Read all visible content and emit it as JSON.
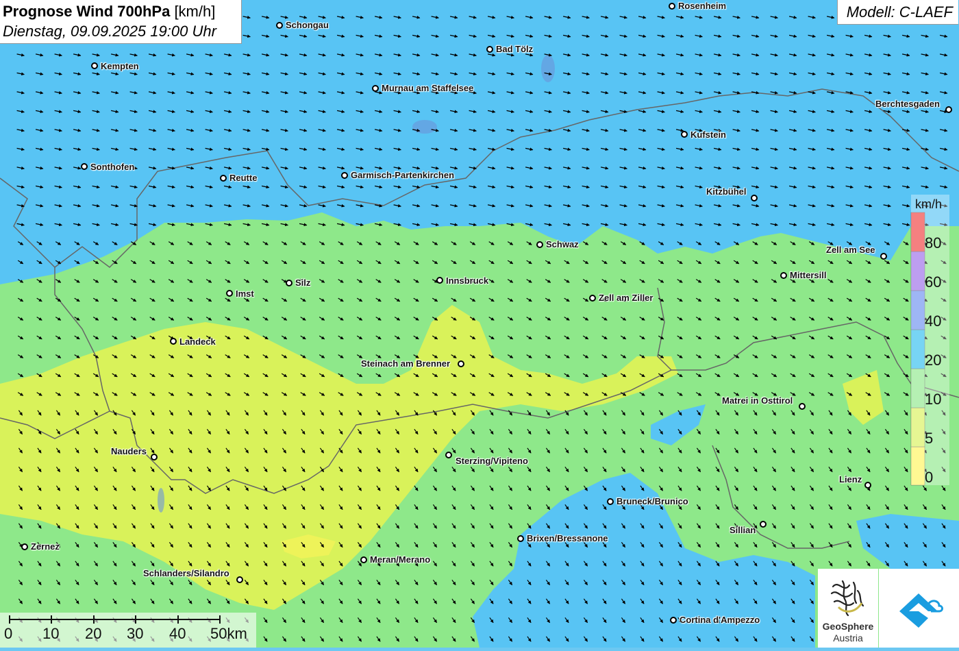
{
  "title": {
    "main": "Prognose Wind 700hPa",
    "unit": "[km/h]",
    "datetime": "Dienstag, 09.09.2025 19:00 Uhr"
  },
  "model": "Modell: C-LAEF",
  "legend": {
    "unit": "km/h",
    "bins": [
      {
        "label": "0",
        "color": "#fff45a"
      },
      {
        "label": "5",
        "color": "#d9f25a"
      },
      {
        "label": "10",
        "color": "#8ee88a"
      },
      {
        "label": "20",
        "color": "#2ebdee"
      },
      {
        "label": "40",
        "color": "#6a8ff0"
      },
      {
        "label": "60",
        "color": "#9a6ae8"
      },
      {
        "label": "80",
        "color": "#f03c3c"
      }
    ]
  },
  "cities": [
    {
      "name": "Rosenheim"
    },
    {
      "name": "Schongau"
    },
    {
      "name": "Bad Tölz"
    },
    {
      "name": "Kempten"
    },
    {
      "name": "Murnau am Staffelsee"
    },
    {
      "name": "Berchtesgaden"
    },
    {
      "name": "Kufstein"
    },
    {
      "name": "Sonthofen"
    },
    {
      "name": "Reutte"
    },
    {
      "name": "Garmisch-Partenkirchen"
    },
    {
      "name": "Kitzbühel"
    },
    {
      "name": "Schwaz"
    },
    {
      "name": "Zell am See"
    },
    {
      "name": "Mittersill"
    },
    {
      "name": "Silz"
    },
    {
      "name": "Innsbruck"
    },
    {
      "name": "Imst"
    },
    {
      "name": "Zell am Ziller"
    },
    {
      "name": "Landeck"
    },
    {
      "name": "Steinach am Brenner"
    },
    {
      "name": "Matrei in Osttirol"
    },
    {
      "name": "Nauders"
    },
    {
      "name": "Sterzing/Vipiteno"
    },
    {
      "name": "Lienz"
    },
    {
      "name": "Bruneck/Brunico"
    },
    {
      "name": "Sillian"
    },
    {
      "name": "Brixen/Bressanone"
    },
    {
      "name": "Zernez"
    },
    {
      "name": "Meran/Merano"
    },
    {
      "name": "Schlanders/Silandro"
    },
    {
      "name": "Cortina d'Ampezzo"
    }
  ],
  "scale_bar": {
    "labels": [
      "0",
      "10",
      "20",
      "30",
      "40",
      "50km"
    ]
  },
  "logos": {
    "geosphere_line1": "GeoSphere",
    "geosphere_line2": "Austria",
    "geosphere_icon": "geosphere-austria-logo-icon",
    "app_icon": "weather-app-logo-icon"
  }
}
